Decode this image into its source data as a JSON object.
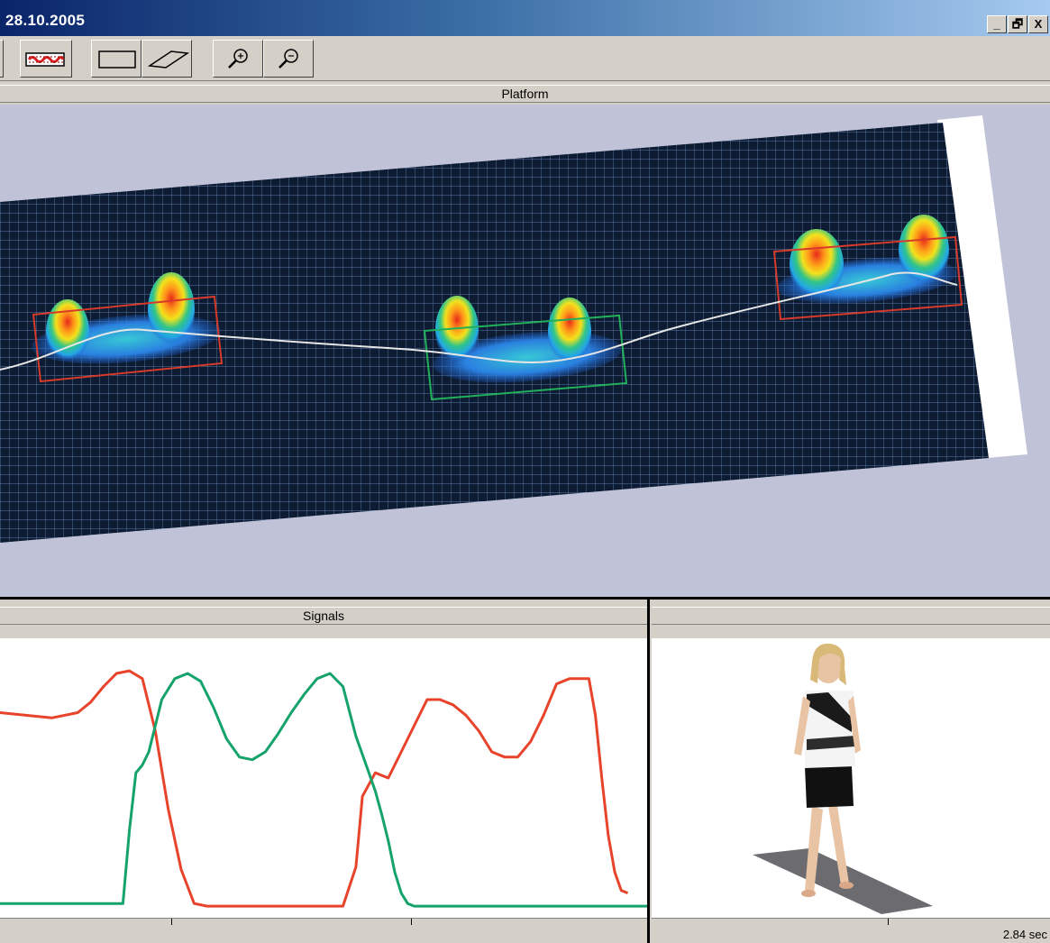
{
  "window": {
    "title": "28.10.2005",
    "minimize_label": "_",
    "restore_label": "🗗",
    "close_label": "X"
  },
  "toolbar": {
    "buttons": [
      {
        "name": "pressure-map-button",
        "icon": "pressure-map-icon"
      },
      {
        "name": "rectangle-select-button",
        "icon": "rectangle-icon"
      },
      {
        "name": "parallelogram-select-button",
        "icon": "parallelogram-icon"
      },
      {
        "name": "zoom-in-button",
        "icon": "zoom-in-icon"
      },
      {
        "name": "zoom-out-button",
        "icon": "zoom-out-icon"
      }
    ]
  },
  "panels": {
    "platform_title": "Platform",
    "signals_title": "Signals",
    "video_title": ""
  },
  "status": {
    "time": "2.84 sec"
  },
  "colors": {
    "platform_bg": "#c0c3d8",
    "grid_bg": "#0d1c33",
    "grid_line": "#5b79a6",
    "left_foot": "#e8432b",
    "right_foot": "#16a36b"
  },
  "chart_data": {
    "type": "line",
    "title": "",
    "xlabel": "",
    "ylabel": "",
    "xlim": [
      0,
      100
    ],
    "ylim": [
      0,
      100
    ],
    "grid": false,
    "series": [
      {
        "color": "#e8432b",
        "x": [
          0,
          4,
          8,
          12,
          14,
          16,
          18,
          20,
          22,
          24,
          26,
          28,
          30,
          32,
          34,
          36,
          38,
          40,
          42,
          53,
          55,
          56,
          58,
          60,
          62,
          64,
          66,
          68,
          70,
          72,
          74,
          76,
          78,
          80,
          82,
          84,
          86,
          88,
          90,
          91,
          92,
          93,
          94,
          95,
          96,
          97
        ],
        "y": [
          75,
          74,
          73,
          75,
          79,
          85,
          90,
          91,
          88,
          68,
          38,
          15,
          2,
          1,
          1,
          1,
          1,
          1,
          1,
          1,
          16,
          43,
          52,
          50,
          60,
          70,
          80,
          80,
          78,
          74,
          68,
          60,
          58,
          58,
          64,
          74,
          86,
          88,
          88,
          88,
          74,
          50,
          28,
          14,
          7,
          6
        ]
      },
      {
        "color": "#16a36b",
        "x": [
          0,
          4,
          10,
          19,
          20,
          21,
          22,
          23,
          25,
          27,
          29,
          31,
          33,
          35,
          37,
          39,
          41,
          43,
          45,
          47,
          49,
          51,
          53,
          55,
          56,
          57,
          58,
          59,
          60,
          61,
          62,
          63,
          64,
          65,
          70,
          80,
          90,
          100
        ],
        "y": [
          2,
          2,
          2,
          2,
          30,
          52,
          55,
          60,
          80,
          88,
          90,
          87,
          77,
          65,
          58,
          57,
          60,
          67,
          75,
          82,
          88,
          90,
          85,
          66,
          59,
          52,
          45,
          36,
          26,
          14,
          6,
          2,
          1,
          1,
          1,
          1,
          1,
          1
        ]
      }
    ]
  }
}
